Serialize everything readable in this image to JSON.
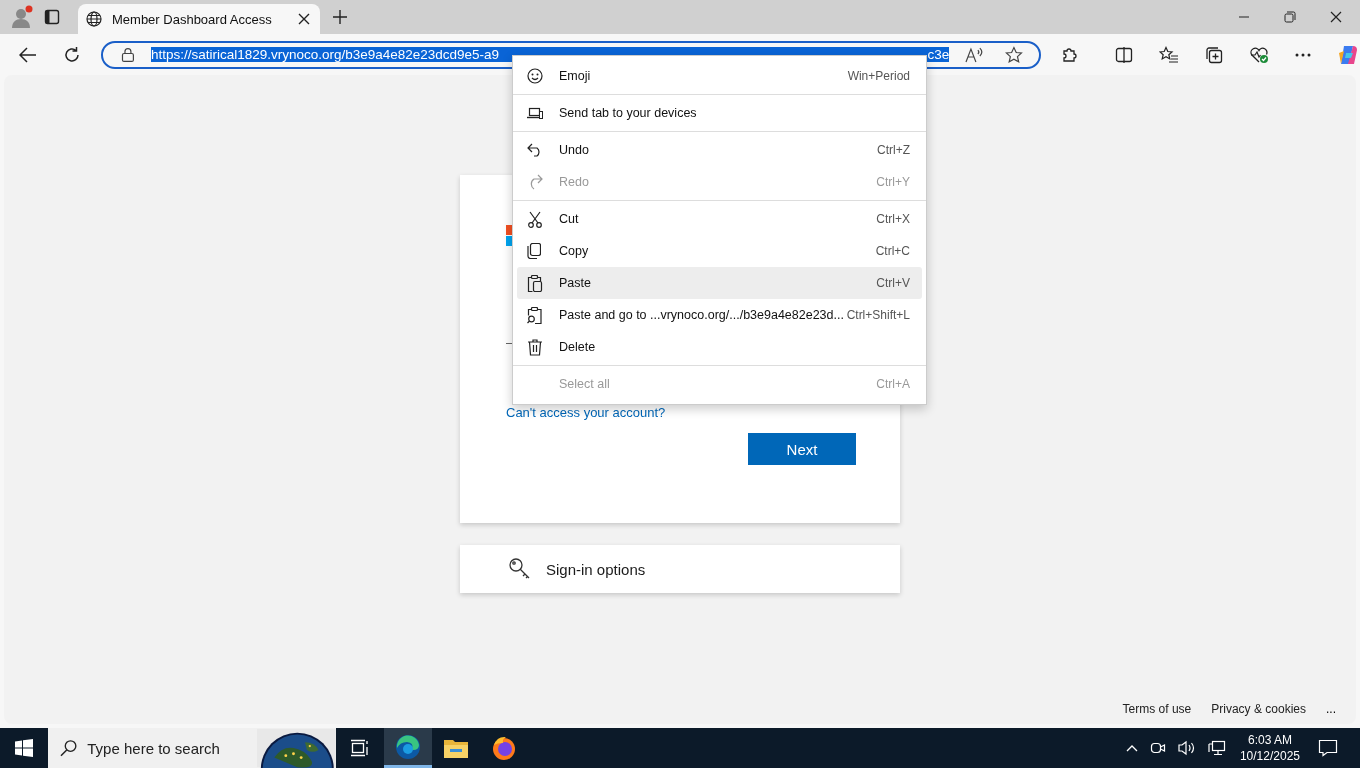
{
  "window": {
    "title": "Member Dashboard Access"
  },
  "address_bar": {
    "url": "https://satirical1829.vrynoco.org/b3e9a4e82e23dcd9e5-a9",
    "url_end": "c3e",
    "selected": true
  },
  "context_menu": {
    "items": [
      {
        "kind": "emoji",
        "label": "Emoji",
        "shortcut": "Win+Period",
        "disabled": false,
        "selected": false
      },
      {
        "kind": "separator"
      },
      {
        "kind": "devices",
        "label": "Send tab to your devices",
        "disabled": false,
        "selected": false
      },
      {
        "kind": "separator"
      },
      {
        "kind": "undo",
        "label": "Undo",
        "shortcut": "Ctrl+Z",
        "disabled": false,
        "selected": false
      },
      {
        "kind": "redo",
        "label": "Redo",
        "shortcut": "Ctrl+Y",
        "disabled": true,
        "selected": false
      },
      {
        "kind": "separator"
      },
      {
        "kind": "cut",
        "label": "Cut",
        "shortcut": "Ctrl+X",
        "disabled": false,
        "selected": false
      },
      {
        "kind": "copy",
        "label": "Copy",
        "shortcut": "Ctrl+C",
        "disabled": false,
        "selected": false
      },
      {
        "kind": "paste",
        "label": "Paste",
        "shortcut": "Ctrl+V",
        "disabled": false,
        "selected": true
      },
      {
        "kind": "pastego",
        "label": "Paste and go to ...vrynoco.org/.../b3e9a4e82e23d...",
        "shortcut": "Ctrl+Shift+L",
        "disabled": false,
        "selected": false
      },
      {
        "kind": "delete",
        "label": "Delete",
        "disabled": false,
        "selected": false
      },
      {
        "kind": "separator"
      },
      {
        "kind": "plain",
        "label": "Select all",
        "shortcut": "Ctrl+A",
        "disabled": true,
        "selected": false
      }
    ]
  },
  "signin_card": {
    "link": "Can't access your account?",
    "next_button": "Next"
  },
  "options_card": {
    "label": "Sign-in options"
  },
  "footer": {
    "links": [
      "Terms of use",
      "Privacy & cookies"
    ],
    "more": "..."
  },
  "taskbar": {
    "search_placeholder": "Type here to search",
    "apps": [
      {
        "kind": "edge",
        "selected": true
      },
      {
        "kind": "folder",
        "selected": false
      },
      {
        "kind": "firefox",
        "selected": false
      }
    ],
    "time": "6:03 AM",
    "date": "10/12/2025"
  }
}
